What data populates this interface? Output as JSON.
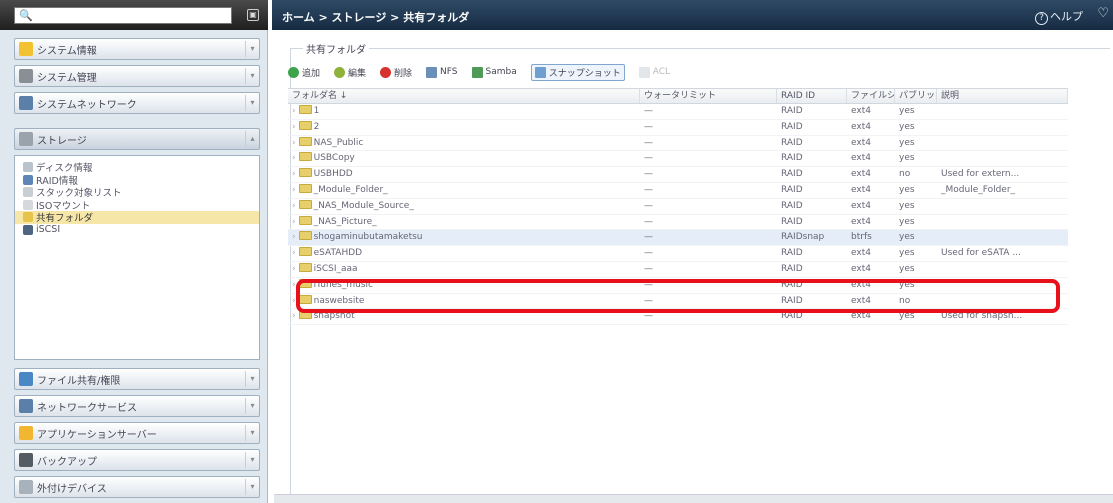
{
  "search": {
    "placeholder": ""
  },
  "sidebar": {
    "menus": [
      {
        "label": "システム情報",
        "icon": "info-icon"
      },
      {
        "label": "システム管理",
        "icon": "tools-icon"
      },
      {
        "label": "システムネットワーク",
        "icon": "network-icon"
      },
      {
        "label": "ストレージ",
        "icon": "storage-icon"
      }
    ],
    "storage_items": [
      {
        "label": "ディスク情報"
      },
      {
        "label": "RAID情報"
      },
      {
        "label": "スタック対象リスト"
      },
      {
        "label": "ISOマウント"
      },
      {
        "label": "共有フォルダ"
      },
      {
        "label": "iSCSI"
      }
    ],
    "bottom_menus": [
      {
        "label": "ファイル共有/権限"
      },
      {
        "label": "ネットワークサービス"
      },
      {
        "label": "アプリケーションサーバー"
      },
      {
        "label": "バックアップ"
      },
      {
        "label": "外付けデバイス"
      }
    ]
  },
  "header": {
    "breadcrumb": "ホーム > ストレージ > 共有フォルダ",
    "help": "ヘルプ"
  },
  "panel": {
    "title": "共有フォルダ",
    "toolbar": {
      "add": "追加",
      "edit": "編集",
      "delete": "削除",
      "nfs": "NFS",
      "samba": "Samba",
      "snapshot": "スナップショット",
      "acl": "ACL"
    },
    "columns": [
      "フォルダ名 ↓",
      "ウォータリミット",
      "RAID ID",
      "ファイルシ...",
      "パブリック",
      "説明"
    ],
    "rows": [
      {
        "name": "1",
        "quota": "—",
        "raid": "RAID",
        "fs": "ext4",
        "public": "yes",
        "desc": ""
      },
      {
        "name": "2",
        "quota": "—",
        "raid": "RAID",
        "fs": "ext4",
        "public": "yes",
        "desc": ""
      },
      {
        "name": "NAS_Public",
        "quota": "—",
        "raid": "RAID",
        "fs": "ext4",
        "public": "yes",
        "desc": ""
      },
      {
        "name": "USBCopy",
        "quota": "—",
        "raid": "RAID",
        "fs": "ext4",
        "public": "yes",
        "desc": ""
      },
      {
        "name": "USBHDD",
        "quota": "—",
        "raid": "RAID",
        "fs": "ext4",
        "public": "no",
        "desc": "Used for extern..."
      },
      {
        "name": "_Module_Folder_",
        "quota": "—",
        "raid": "RAID",
        "fs": "ext4",
        "public": "yes",
        "desc": "_Module_Folder_"
      },
      {
        "name": "_NAS_Module_Source_",
        "quota": "—",
        "raid": "RAID",
        "fs": "ext4",
        "public": "yes",
        "desc": ""
      },
      {
        "name": "_NAS_Picture_",
        "quota": "—",
        "raid": "RAID",
        "fs": "ext4",
        "public": "yes",
        "desc": ""
      },
      {
        "name": "shogaminubutamaketsu",
        "quota": "—",
        "raid": "RAIDsnap",
        "fs": "btrfs",
        "public": "yes",
        "desc": ""
      },
      {
        "name": "eSATAHDD",
        "quota": "—",
        "raid": "RAID",
        "fs": "ext4",
        "public": "yes",
        "desc": "Used for eSATA ..."
      },
      {
        "name": "iSCSI_aaa",
        "quota": "—",
        "raid": "RAID",
        "fs": "ext4",
        "public": "yes",
        "desc": ""
      },
      {
        "name": "iTunes_music",
        "quota": "—",
        "raid": "RAID",
        "fs": "ext4",
        "public": "yes",
        "desc": ""
      },
      {
        "name": "naswebsite",
        "quota": "—",
        "raid": "RAID",
        "fs": "ext4",
        "public": "no",
        "desc": ""
      },
      {
        "name": "snapshot",
        "quota": "—",
        "raid": "RAID",
        "fs": "ext4",
        "public": "yes",
        "desc": "Used for snapsh..."
      }
    ]
  },
  "colors": {
    "highlight": "#e8101a",
    "topbar": "#1e3550",
    "selected_nav": "#f6e7a8"
  }
}
